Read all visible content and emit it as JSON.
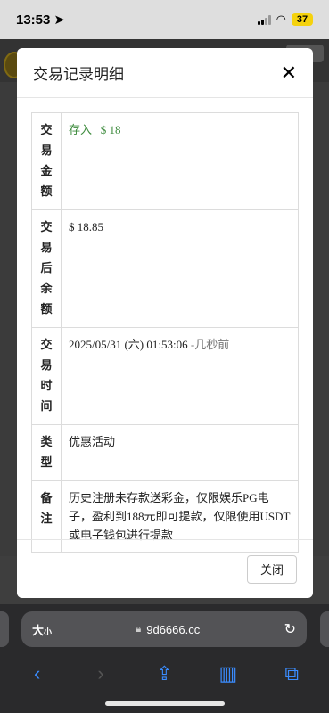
{
  "status": {
    "time": "13:53",
    "battery": "37"
  },
  "modal": {
    "title": "交易记录明细",
    "close_symbol": "✕",
    "close_button_label": "关闭",
    "rows": [
      {
        "key": "交易金额",
        "value_type": "存入",
        "value_amount": "$ 18"
      },
      {
        "key": "交易后余额",
        "value": "$ 18.85"
      },
      {
        "key": "交易时间",
        "value_time": "2025/05/31 (六) 01:53:06",
        "value_relative": "-几秒前"
      },
      {
        "key": "类型",
        "value": "优惠活动"
      },
      {
        "key": "备注",
        "value": "历史注册未存款送彩金，仅限娱乐PG电子，盈利到188元即可提款，仅限使用USDT或电子钱包进行提款"
      }
    ]
  },
  "browser": {
    "text_size_label": "大",
    "text_size_small": "小",
    "url": "9d6666.cc"
  },
  "icons": {
    "location": "location-arrow-icon",
    "signal": "cellular-signal-icon",
    "wifi": "wifi-icon",
    "lock": "lock-icon",
    "reload": "reload-icon",
    "back": "back-chevron-icon",
    "forward": "forward-chevron-icon",
    "share": "share-icon",
    "bookmarks": "bookmarks-icon",
    "tabs": "tabs-icon"
  },
  "colors": {
    "accent": "#3a8cff",
    "deposit_green": "#3d8b3d",
    "battery": "#f5d20d"
  }
}
